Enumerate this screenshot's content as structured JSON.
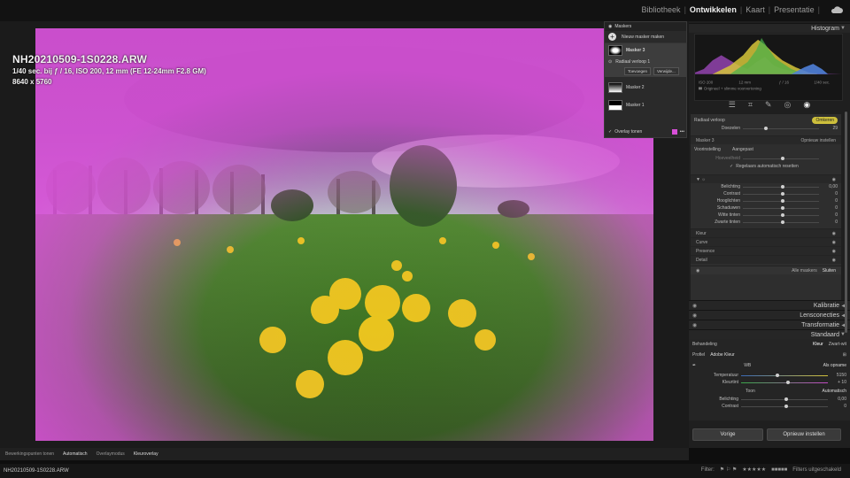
{
  "modules": [
    "Bibliotheek",
    "Ontwikkelen",
    "Kaart",
    "Presentatie"
  ],
  "active_module": "Ontwikkelen",
  "photo": {
    "filename": "NH20210509-1S0228.ARW",
    "exif": "1/40 sec. bij ƒ / 16, ISO 200, 12 mm (FE 12-24mm F2.8 GM)",
    "dimensions": "8640 x 5760"
  },
  "masks_panel": {
    "title": "Maskers",
    "new_mask": "Nieuw masker maken",
    "items": [
      {
        "label": "Masker 3",
        "selected": true
      },
      {
        "label": "Radiaal verloop 1",
        "sub": true
      },
      {
        "label": "Masker 2"
      },
      {
        "label": "Masker 1"
      }
    ],
    "btn_add": "Toevoegen",
    "btn_subtract": "Verwijde...",
    "overlay_label": "Overlay tonen",
    "overlay_color": "#d84fd8"
  },
  "histogram": {
    "title": "Histogram",
    "readout": [
      "ISO 200",
      "12 mm",
      "ƒ / 16",
      "1/40 sec."
    ],
    "original_label": "Origineel + slimme voorvertoning"
  },
  "mask_settings": {
    "header": "Radiaal verloop",
    "invert_label": "Omkeren",
    "feather_label": "Doezelen",
    "feather_value": "29",
    "feather_level": 0.28,
    "mask_name": "Masker 3",
    "create_new": "Opnieuw instellen",
    "preset_label": "Voorinstelling",
    "preset_value": "Aangepast",
    "amount_label": "Hoeveelheid",
    "auto_reset": "Regelaars automatisch resetten"
  },
  "tone_sliders": [
    {
      "name": "Belichting",
      "value": "0,00",
      "level": 0.5
    },
    {
      "name": "Contrast",
      "value": "0",
      "level": 0.5
    },
    {
      "name": "Hooglichten",
      "value": "0",
      "level": 0.5
    },
    {
      "name": "Schaduwen",
      "value": "0",
      "level": 0.5
    },
    {
      "name": "Witte tinten",
      "value": "0",
      "level": 0.5
    },
    {
      "name": "Zwarte tinten",
      "value": "0",
      "level": 0.5
    }
  ],
  "subsections": [
    "Kleur",
    "Curve",
    "Presence",
    "Detail"
  ],
  "show_all": "Alle maskers",
  "close_label": "Sluiten",
  "panels": [
    "Kalibratie",
    "Lensconecties",
    "Transformatie",
    "Standaard"
  ],
  "basic": {
    "treatment_label": "Behandeling",
    "treatment_value": "Kleur",
    "treatment_alt": "Zwart-wit",
    "profile_label": "Profiel",
    "profile_value": "Adobe Kleur",
    "wb_label": "WB",
    "wb_value": "Als opname",
    "temp_label": "Temperatuur",
    "temp_value": "5150",
    "tint_label": "Kleurtint",
    "tint_value": "+ 10",
    "tone_label": "Toon",
    "auto_label": "Automatisch",
    "exposure_label": "Belichting",
    "exposure_value": "0,00",
    "contrast_label": "Contrast",
    "contrast_value": "0"
  },
  "buttons": {
    "previous": "Vorige",
    "reset": "Opnieuw instellen"
  },
  "statusbar": {
    "show_label": "Bewerkingspunten tonen",
    "show_value": "Automatisch",
    "overlay_label": "Overlaymodus",
    "overlay_value": "Kleuroverlay"
  },
  "filmstrip": {
    "path": "NH20210509-1S0228.ARW",
    "filter_label": "Filter:",
    "filter_value": "Filters uitgeschakeld"
  }
}
